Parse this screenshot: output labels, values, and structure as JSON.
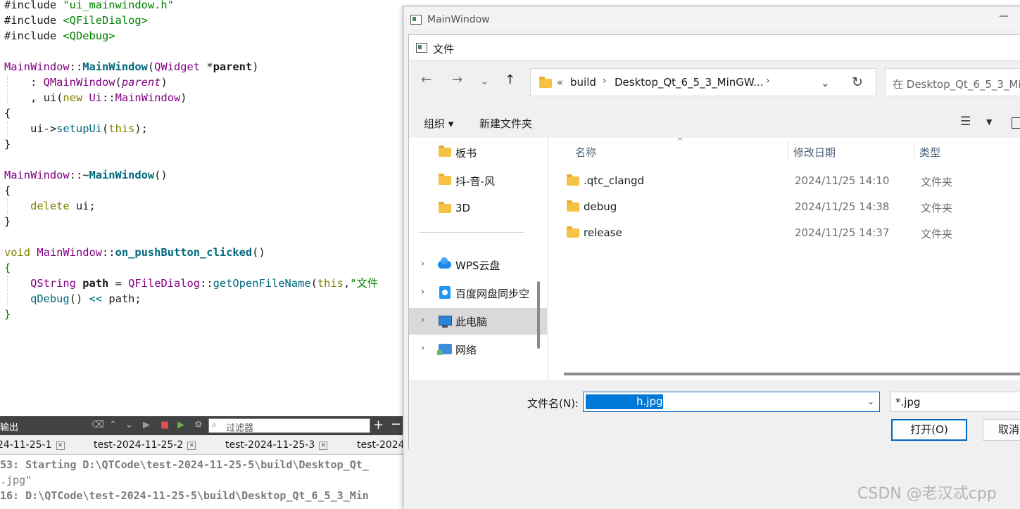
{
  "editor": {
    "l1_a": "#include ",
    "l1_b": "\"ui_mainwindow.h\"",
    "l2_a": "#include ",
    "l2_b": "<QFileDialog>",
    "l3_a": "#include ",
    "l3_b": "<QDebug>",
    "l5_cls": "MainWindow",
    "l5_sep": "::",
    "l5_fn": "MainWindow",
    "l5_p1": "(",
    "l5_type": "QWidget",
    "l5_star": " *",
    "l5_arg": "parent",
    "l5_p2": ")",
    "l6_a": "    : ",
    "l6_cls": "QMainWindow",
    "l6_p1": "(",
    "l6_arg": "parent",
    "l6_p2": ")",
    "l7_a": "    , ui(",
    "l7_kw": "new",
    "l7_sp": " ",
    "l7_cls": "Ui",
    "l7_sep": "::",
    "l7_cls2": "MainWindow",
    "l7_p2": ")",
    "l8": "{",
    "l9_a": "    ui->",
    "l9_fn": "setupUi",
    "l9_p1": "(",
    "l9_kw": "this",
    "l9_p2": ");",
    "l10": "}",
    "l12_cls": "MainWindow",
    "l12_sep": "::~",
    "l12_fn": "MainWindow",
    "l12_p": "()",
    "l13": "{",
    "l14_a": "    ",
    "l14_kw": "delete",
    "l14_b": " ui;",
    "l15": "}",
    "l17_kw": "void",
    "l17_sp": " ",
    "l17_cls": "MainWindow",
    "l17_sep": "::",
    "l17_fn": "on_pushButton_clicked",
    "l17_p": "()",
    "l18": "{",
    "l19_a": "    ",
    "l19_cls": "QString",
    "l19_sp": " ",
    "l19_var": "path",
    "l19_eq": " = ",
    "l19_cls2": "QFileDialog",
    "l19_sep": "::",
    "l19_fn": "getOpenFileName",
    "l19_p1": "(",
    "l19_kw": "this",
    "l19_c": ",",
    "l19_str": "\"文件",
    "l20_a": "    ",
    "l20_fn": "qDebug",
    "l20_b": "() ",
    "l20_op": "<<",
    "l20_c": " path;",
    "l21": "}"
  },
  "output": {
    "title": "输出",
    "filter_placeholder": "过滤器",
    "tabs": [
      "24-11-25-1",
      "test-2024-11-25-2",
      "test-2024-11-25-3",
      "test-2024"
    ],
    "lines": [
      "53: Starting D:\\QTCode\\test-2024-11-25-5\\build\\Desktop_Qt_",
      ".jpg\"",
      "16: D:\\QTCode\\test-2024-11-25-5\\build\\Desktop_Qt_6_5_3_Min"
    ]
  },
  "mainwindow": {
    "title": "MainWindow",
    "minimize": "—"
  },
  "dialog": {
    "title": "文件",
    "address": {
      "prefix": "«",
      "crumbs": [
        "build",
        "Desktop_Qt_6_5_3_MinGW..."
      ]
    },
    "search_placeholder": "在 Desktop_Qt_6_5_3_Mi...",
    "commands": {
      "organize": "组织 ▾",
      "new_folder": "新建文件夹"
    },
    "nav_items": [
      {
        "label": "板书"
      },
      {
        "label": "抖-音-风"
      },
      {
        "label": "3D"
      },
      {
        "label": "WPS云盘"
      },
      {
        "label": "百度网盘同步空"
      },
      {
        "label": "此电脑"
      },
      {
        "label": "网络"
      }
    ],
    "columns": {
      "name": "名称",
      "modified": "修改日期",
      "type": "类型"
    },
    "files": [
      {
        "name": ".qtc_clangd",
        "modified": "2024/11/25 14:10",
        "type": "文件夹"
      },
      {
        "name": "debug",
        "modified": "2024/11/25 14:38",
        "type": "文件夹"
      },
      {
        "name": "release",
        "modified": "2024/11/25 14:37",
        "type": "文件夹"
      }
    ],
    "filename_label": "文件名(N):",
    "filename_value": "h.jpg",
    "filter_value": "*.jpg",
    "open_button": "打开(O)",
    "cancel_button": "取消"
  },
  "watermark": "CSDN @老汉忒cpp"
}
